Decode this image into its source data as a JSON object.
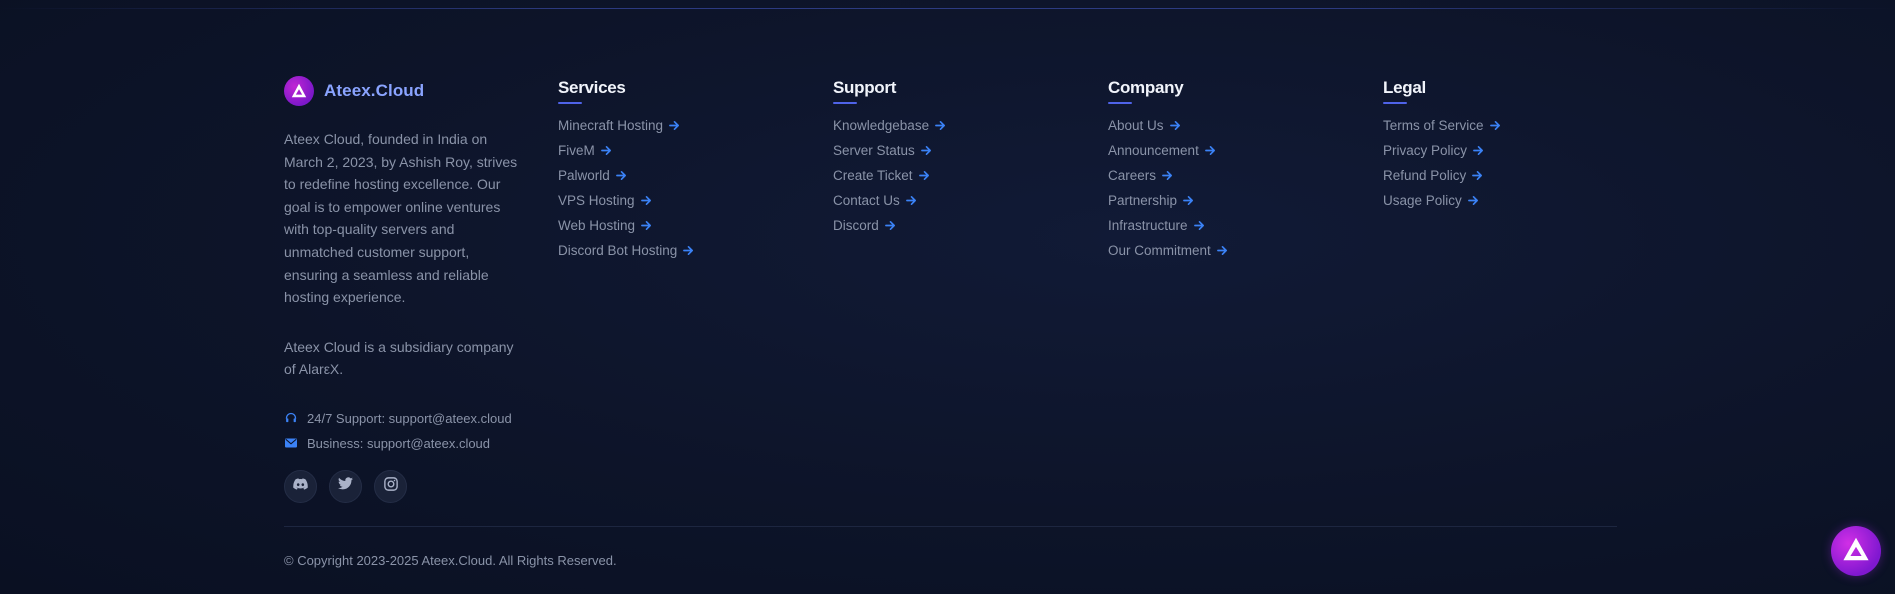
{
  "brand": {
    "name": "Ateex.Cloud",
    "description": "Ateex Cloud, founded in India on March 2, 2023, by Ashish Roy, strives to redefine hosting excellence. Our goal is to empower online ventures with top-quality servers and unmatched customer support, ensuring a seamless and reliable hosting experience.",
    "subsidiary": "Ateex Cloud is a subsidiary company of AlarεX.",
    "support_contact": "24/7 Support: support@ateex.cloud",
    "business_contact": "Business: support@ateex.cloud"
  },
  "socials": [
    "discord-icon",
    "twitter-icon",
    "instagram-icon"
  ],
  "columns": {
    "services": {
      "title": "Services",
      "links": [
        "Minecraft Hosting",
        "FiveM",
        "Palworld",
        "VPS Hosting",
        "Web Hosting",
        "Discord Bot Hosting"
      ]
    },
    "support": {
      "title": "Support",
      "links": [
        "Knowledgebase",
        "Server Status",
        "Create Ticket",
        "Contact Us",
        "Discord"
      ]
    },
    "company": {
      "title": "Company",
      "links": [
        "About Us",
        "Announcement",
        "Careers",
        "Partnership",
        "Infrastructure",
        "Our Commitment"
      ]
    },
    "legal": {
      "title": "Legal",
      "links": [
        "Terms of Service",
        "Privacy Policy",
        "Refund Policy",
        "Usage Policy"
      ]
    }
  },
  "copyright": "© Copyright 2023-2025 Ateex.Cloud. All Rights Reserved.",
  "colors": {
    "background": "#0c1226",
    "accent": "#4f63e8",
    "brand_text": "#8aa4ff",
    "arrow": "#3b82f6",
    "logo_gradient": "#c026d3"
  }
}
